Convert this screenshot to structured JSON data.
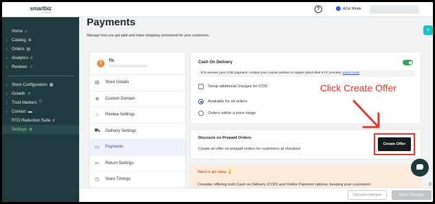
{
  "app": {
    "logo_text": "smartbiz",
    "logo_sub": "by amazon"
  },
  "sidebar": {
    "items": [
      {
        "label": "Home",
        "icon": "home-icon",
        "glyph": "⌂"
      },
      {
        "label": "Catalog",
        "icon": "catalog-icon",
        "glyph": "⊕"
      },
      {
        "label": "Orders",
        "icon": "orders-icon",
        "glyph": "▤"
      },
      {
        "label": "Analytics",
        "icon": "analytics-icon",
        "glyph": "ıl"
      },
      {
        "label": "Reviews",
        "icon": "star-icon",
        "glyph": "☆"
      },
      {
        "label": "Store Configuration",
        "icon": "store-icon",
        "glyph": "▦"
      },
      {
        "label": "Growth",
        "icon": "growth-icon",
        "glyph": "↗"
      },
      {
        "label": "Trust Markers",
        "icon": "shield-icon",
        "glyph": "⛉"
      },
      {
        "label": "Contact",
        "icon": "chat-icon",
        "glyph": "▬"
      },
      {
        "label": "RTO Reduction Suite",
        "icon": "chart-icon",
        "glyph": "ıl"
      },
      {
        "label": "Settings",
        "icon": "gear-icon",
        "glyph": "⚙"
      }
    ]
  },
  "topbar": {
    "help_glyph": "?",
    "mode_label": "AZaI Mode"
  },
  "page": {
    "title": "Payments",
    "subtitle": "Manage how you get paid and make shopping convenient for your customers."
  },
  "store": {
    "avatar_letter": "T",
    "name": "Th"
  },
  "settings_menu": [
    {
      "label": "Store Details",
      "glyph": "▤"
    },
    {
      "label": "Custom Domain",
      "glyph": "⊕"
    },
    {
      "label": "Review Settings",
      "glyph": "☆"
    },
    {
      "label": "Delivery Settings",
      "glyph": "⛟"
    },
    {
      "label": "Payments",
      "glyph": "▭"
    },
    {
      "label": "Return Settings",
      "glyph": "↩"
    },
    {
      "label": "Store Timings",
      "glyph": "◷"
    }
  ],
  "cod": {
    "title": "Cash On Delivery",
    "info_text": "To receive your COD payment, contact your courier partner to inquire about their KYC process.",
    "info_link": "Learn more",
    "info_glyph": "ℹ",
    "setup_label": "Setup additional charges for COD",
    "option_all": "Available for all orders",
    "option_range": "Orders within a price range"
  },
  "annotation": {
    "callout": "Click Create Offer",
    "color": "#e8362a"
  },
  "prepaid": {
    "title": "Discount on Prepaid Orders",
    "subtitle": "Create an offer on prepaid orders for customers at checkout.",
    "button": "Create Offer"
  },
  "idea": {
    "title": "Here's an idea 💡",
    "text": "Consider offering both Cash on Delivery (COD) and Online Payment options, keeping your customers'"
  },
  "footer": {
    "discard": "Discard changes",
    "save": "Save Changes"
  },
  "colors": {
    "sidebar": "#1f3b3d",
    "accent_active": "#7dde8f",
    "toggle_on": "#2faa5c",
    "primary_dark": "#161b1e"
  }
}
